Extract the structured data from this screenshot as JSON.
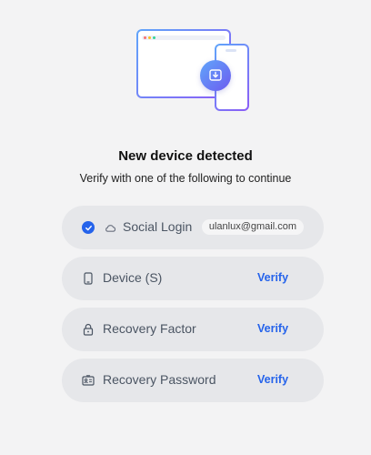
{
  "header": {
    "title": "New device detected",
    "subtitle": "Verify with one of the following to continue"
  },
  "methods": [
    {
      "label": "Social Login",
      "email": "ulanlux@gmail.com",
      "selected": true,
      "icon": "cloud-icon"
    },
    {
      "label": "Device (S)",
      "action": "Verify",
      "icon": "phone-icon"
    },
    {
      "label": "Recovery Factor",
      "action": "Verify",
      "icon": "lock-icon"
    },
    {
      "label": "Recovery Password",
      "action": "Verify",
      "icon": "id-card-icon"
    }
  ],
  "colors": {
    "accent": "#2563eb",
    "background": "#f3f3f4",
    "row_background": "#e6e7ea"
  }
}
